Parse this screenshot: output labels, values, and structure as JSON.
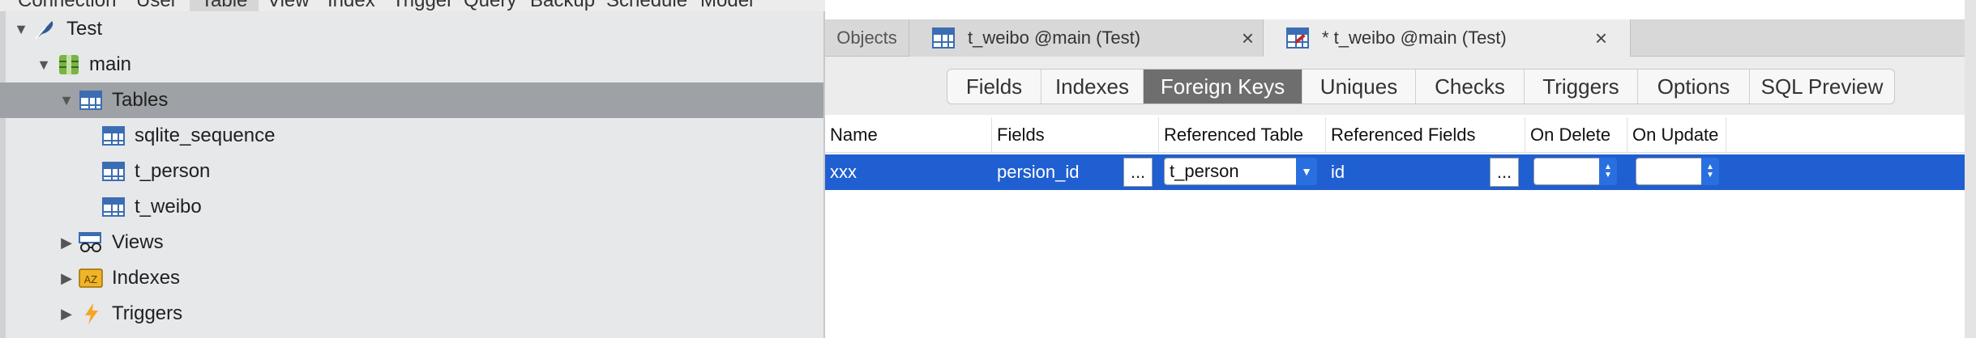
{
  "menu": [
    "Connection",
    "User",
    "Table",
    "View",
    "Index",
    "Trigger",
    "Query",
    "Backup",
    "Schedule",
    "Model"
  ],
  "menu_active": "Table",
  "navigator": {
    "connection": "Test",
    "database": "main",
    "tables_group": "Tables",
    "tables": [
      "sqlite_sequence",
      "t_person",
      "t_weibo"
    ],
    "views_group": "Views",
    "indexes_group": "Indexes",
    "triggers_group": "Triggers"
  },
  "tabs": {
    "objects": "Objects",
    "tab1": "t_weibo @main (Test)",
    "tab2": "* t_weibo @main (Test)",
    "close_glyph": "×"
  },
  "segments": [
    "Fields",
    "Indexes",
    "Foreign Keys",
    "Uniques",
    "Checks",
    "Triggers",
    "Options",
    "SQL Preview"
  ],
  "active_segment": "Foreign Keys",
  "columns": [
    "Name",
    "Fields",
    "Referenced Table",
    "Referenced Fields",
    "On Delete",
    "On Update"
  ],
  "row": {
    "name": "xxx",
    "fields": "persion_id",
    "referenced_table": "t_person",
    "referenced_fields": "id",
    "on_delete": "",
    "on_update": "",
    "ellipsis": "..."
  },
  "colors": {
    "selection": "#1f5fd1",
    "active_segment": "#6e6e6e",
    "navigator_bg": "#e6e8ea",
    "navigator_selected": "#9ea2a6"
  }
}
